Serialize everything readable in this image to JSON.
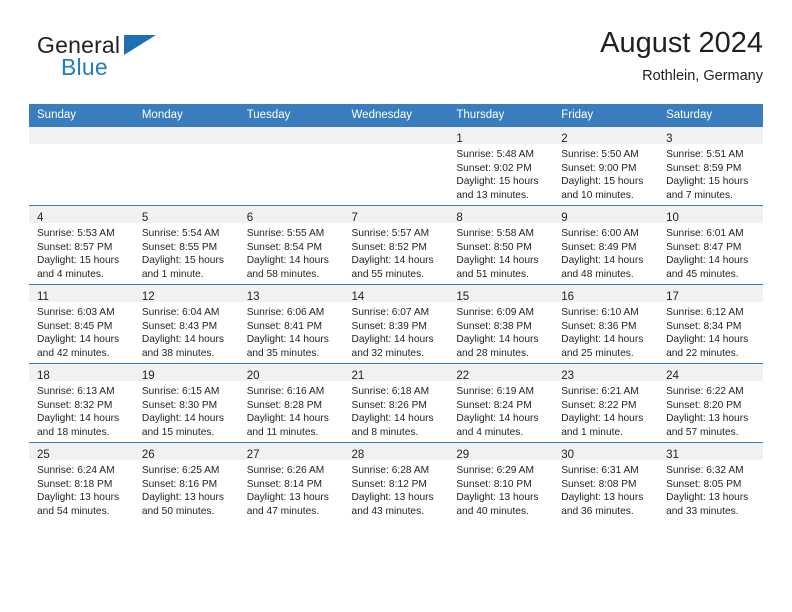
{
  "logo": {
    "word_top": "General",
    "word_bottom": "Blue",
    "triangle_color": "#1f6fb5",
    "blue_color": "#1f7ec4"
  },
  "header": {
    "title": "August 2024",
    "subtitle": "Rothlein, Germany"
  },
  "colors": {
    "header_blue": "#3a7dbf",
    "daynum_strip": "#f1f1f1",
    "text": "#231f20"
  },
  "weekday_headers": [
    "Sunday",
    "Monday",
    "Tuesday",
    "Wednesday",
    "Thursday",
    "Friday",
    "Saturday"
  ],
  "weeks": [
    [
      {
        "day": "",
        "sunrise": "",
        "sunset": "",
        "daylight_1": "",
        "daylight_2": ""
      },
      {
        "day": "",
        "sunrise": "",
        "sunset": "",
        "daylight_1": "",
        "daylight_2": ""
      },
      {
        "day": "",
        "sunrise": "",
        "sunset": "",
        "daylight_1": "",
        "daylight_2": ""
      },
      {
        "day": "",
        "sunrise": "",
        "sunset": "",
        "daylight_1": "",
        "daylight_2": ""
      },
      {
        "day": "1",
        "sunrise": "Sunrise: 5:48 AM",
        "sunset": "Sunset: 9:02 PM",
        "daylight_1": "Daylight: 15 hours",
        "daylight_2": "and 13 minutes."
      },
      {
        "day": "2",
        "sunrise": "Sunrise: 5:50 AM",
        "sunset": "Sunset: 9:00 PM",
        "daylight_1": "Daylight: 15 hours",
        "daylight_2": "and 10 minutes."
      },
      {
        "day": "3",
        "sunrise": "Sunrise: 5:51 AM",
        "sunset": "Sunset: 8:59 PM",
        "daylight_1": "Daylight: 15 hours",
        "daylight_2": "and 7 minutes."
      }
    ],
    [
      {
        "day": "4",
        "sunrise": "Sunrise: 5:53 AM",
        "sunset": "Sunset: 8:57 PM",
        "daylight_1": "Daylight: 15 hours",
        "daylight_2": "and 4 minutes."
      },
      {
        "day": "5",
        "sunrise": "Sunrise: 5:54 AM",
        "sunset": "Sunset: 8:55 PM",
        "daylight_1": "Daylight: 15 hours",
        "daylight_2": "and 1 minute."
      },
      {
        "day": "6",
        "sunrise": "Sunrise: 5:55 AM",
        "sunset": "Sunset: 8:54 PM",
        "daylight_1": "Daylight: 14 hours",
        "daylight_2": "and 58 minutes."
      },
      {
        "day": "7",
        "sunrise": "Sunrise: 5:57 AM",
        "sunset": "Sunset: 8:52 PM",
        "daylight_1": "Daylight: 14 hours",
        "daylight_2": "and 55 minutes."
      },
      {
        "day": "8",
        "sunrise": "Sunrise: 5:58 AM",
        "sunset": "Sunset: 8:50 PM",
        "daylight_1": "Daylight: 14 hours",
        "daylight_2": "and 51 minutes."
      },
      {
        "day": "9",
        "sunrise": "Sunrise: 6:00 AM",
        "sunset": "Sunset: 8:49 PM",
        "daylight_1": "Daylight: 14 hours",
        "daylight_2": "and 48 minutes."
      },
      {
        "day": "10",
        "sunrise": "Sunrise: 6:01 AM",
        "sunset": "Sunset: 8:47 PM",
        "daylight_1": "Daylight: 14 hours",
        "daylight_2": "and 45 minutes."
      }
    ],
    [
      {
        "day": "11",
        "sunrise": "Sunrise: 6:03 AM",
        "sunset": "Sunset: 8:45 PM",
        "daylight_1": "Daylight: 14 hours",
        "daylight_2": "and 42 minutes."
      },
      {
        "day": "12",
        "sunrise": "Sunrise: 6:04 AM",
        "sunset": "Sunset: 8:43 PM",
        "daylight_1": "Daylight: 14 hours",
        "daylight_2": "and 38 minutes."
      },
      {
        "day": "13",
        "sunrise": "Sunrise: 6:06 AM",
        "sunset": "Sunset: 8:41 PM",
        "daylight_1": "Daylight: 14 hours",
        "daylight_2": "and 35 minutes."
      },
      {
        "day": "14",
        "sunrise": "Sunrise: 6:07 AM",
        "sunset": "Sunset: 8:39 PM",
        "daylight_1": "Daylight: 14 hours",
        "daylight_2": "and 32 minutes."
      },
      {
        "day": "15",
        "sunrise": "Sunrise: 6:09 AM",
        "sunset": "Sunset: 8:38 PM",
        "daylight_1": "Daylight: 14 hours",
        "daylight_2": "and 28 minutes."
      },
      {
        "day": "16",
        "sunrise": "Sunrise: 6:10 AM",
        "sunset": "Sunset: 8:36 PM",
        "daylight_1": "Daylight: 14 hours",
        "daylight_2": "and 25 minutes."
      },
      {
        "day": "17",
        "sunrise": "Sunrise: 6:12 AM",
        "sunset": "Sunset: 8:34 PM",
        "daylight_1": "Daylight: 14 hours",
        "daylight_2": "and 22 minutes."
      }
    ],
    [
      {
        "day": "18",
        "sunrise": "Sunrise: 6:13 AM",
        "sunset": "Sunset: 8:32 PM",
        "daylight_1": "Daylight: 14 hours",
        "daylight_2": "and 18 minutes."
      },
      {
        "day": "19",
        "sunrise": "Sunrise: 6:15 AM",
        "sunset": "Sunset: 8:30 PM",
        "daylight_1": "Daylight: 14 hours",
        "daylight_2": "and 15 minutes."
      },
      {
        "day": "20",
        "sunrise": "Sunrise: 6:16 AM",
        "sunset": "Sunset: 8:28 PM",
        "daylight_1": "Daylight: 14 hours",
        "daylight_2": "and 11 minutes."
      },
      {
        "day": "21",
        "sunrise": "Sunrise: 6:18 AM",
        "sunset": "Sunset: 8:26 PM",
        "daylight_1": "Daylight: 14 hours",
        "daylight_2": "and 8 minutes."
      },
      {
        "day": "22",
        "sunrise": "Sunrise: 6:19 AM",
        "sunset": "Sunset: 8:24 PM",
        "daylight_1": "Daylight: 14 hours",
        "daylight_2": "and 4 minutes."
      },
      {
        "day": "23",
        "sunrise": "Sunrise: 6:21 AM",
        "sunset": "Sunset: 8:22 PM",
        "daylight_1": "Daylight: 14 hours",
        "daylight_2": "and 1 minute."
      },
      {
        "day": "24",
        "sunrise": "Sunrise: 6:22 AM",
        "sunset": "Sunset: 8:20 PM",
        "daylight_1": "Daylight: 13 hours",
        "daylight_2": "and 57 minutes."
      }
    ],
    [
      {
        "day": "25",
        "sunrise": "Sunrise: 6:24 AM",
        "sunset": "Sunset: 8:18 PM",
        "daylight_1": "Daylight: 13 hours",
        "daylight_2": "and 54 minutes."
      },
      {
        "day": "26",
        "sunrise": "Sunrise: 6:25 AM",
        "sunset": "Sunset: 8:16 PM",
        "daylight_1": "Daylight: 13 hours",
        "daylight_2": "and 50 minutes."
      },
      {
        "day": "27",
        "sunrise": "Sunrise: 6:26 AM",
        "sunset": "Sunset: 8:14 PM",
        "daylight_1": "Daylight: 13 hours",
        "daylight_2": "and 47 minutes."
      },
      {
        "day": "28",
        "sunrise": "Sunrise: 6:28 AM",
        "sunset": "Sunset: 8:12 PM",
        "daylight_1": "Daylight: 13 hours",
        "daylight_2": "and 43 minutes."
      },
      {
        "day": "29",
        "sunrise": "Sunrise: 6:29 AM",
        "sunset": "Sunset: 8:10 PM",
        "daylight_1": "Daylight: 13 hours",
        "daylight_2": "and 40 minutes."
      },
      {
        "day": "30",
        "sunrise": "Sunrise: 6:31 AM",
        "sunset": "Sunset: 8:08 PM",
        "daylight_1": "Daylight: 13 hours",
        "daylight_2": "and 36 minutes."
      },
      {
        "day": "31",
        "sunrise": "Sunrise: 6:32 AM",
        "sunset": "Sunset: 8:05 PM",
        "daylight_1": "Daylight: 13 hours",
        "daylight_2": "and 33 minutes."
      }
    ]
  ]
}
